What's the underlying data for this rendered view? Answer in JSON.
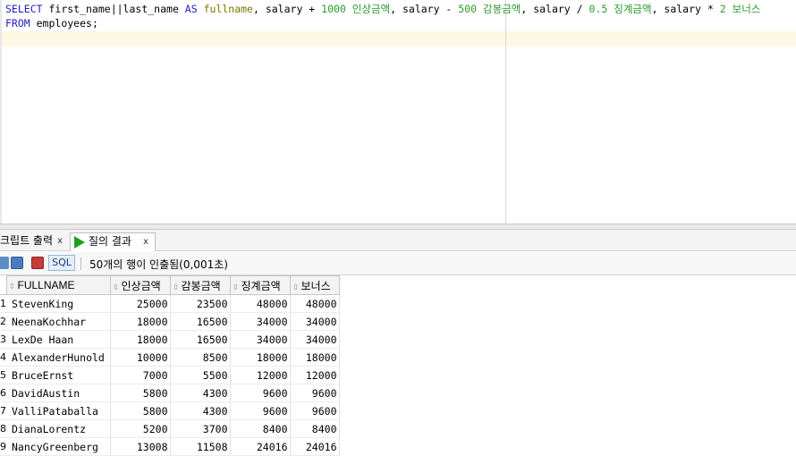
{
  "editor": {
    "line1": [
      {
        "t": "SELECT",
        "c": "kw"
      },
      {
        "t": " first_name||last_name ",
        "c": ""
      },
      {
        "t": "AS",
        "c": "kw"
      },
      {
        "t": " ",
        "c": ""
      },
      {
        "t": "fullname",
        "c": "alias"
      },
      {
        "t": ", salary + ",
        "c": ""
      },
      {
        "t": "1000",
        "c": "num"
      },
      {
        "t": " ",
        "c": ""
      },
      {
        "t": "인상금액",
        "c": "kor"
      },
      {
        "t": ", salary - ",
        "c": ""
      },
      {
        "t": "500",
        "c": "num"
      },
      {
        "t": " ",
        "c": ""
      },
      {
        "t": "감봉금액",
        "c": "kor"
      },
      {
        "t": ", salary / ",
        "c": ""
      },
      {
        "t": "0.5",
        "c": "num"
      },
      {
        "t": " ",
        "c": ""
      },
      {
        "t": "징계금액",
        "c": "kor"
      },
      {
        "t": ", salary * ",
        "c": ""
      },
      {
        "t": "2",
        "c": "num"
      },
      {
        "t": " ",
        "c": ""
      },
      {
        "t": "보너스",
        "c": "kor"
      }
    ],
    "line2": [
      {
        "t": "FROM",
        "c": "kw"
      },
      {
        "t": " employees;",
        "c": ""
      }
    ]
  },
  "tabs": {
    "script_output": "크립트 출력",
    "query_result": "질의 결과",
    "close": "x"
  },
  "toolbar": {
    "sql_label": "SQL",
    "separator": "|",
    "status": "50개의 행이 인출됨(0,001초)"
  },
  "grid": {
    "columns": [
      "FULLNAME",
      "인상금액",
      "감봉금액",
      "징계금액",
      "보너스"
    ],
    "rows": [
      {
        "rn": "1",
        "fullname": "StevenKing",
        "raise": "25000",
        "cut": "23500",
        "penalty": "48000",
        "bonus": "48000"
      },
      {
        "rn": "2",
        "fullname": "NeenaKochhar",
        "raise": "18000",
        "cut": "16500",
        "penalty": "34000",
        "bonus": "34000"
      },
      {
        "rn": "3",
        "fullname": "LexDe Haan",
        "raise": "18000",
        "cut": "16500",
        "penalty": "34000",
        "bonus": "34000"
      },
      {
        "rn": "4",
        "fullname": "AlexanderHunold",
        "raise": "10000",
        "cut": "8500",
        "penalty": "18000",
        "bonus": "18000"
      },
      {
        "rn": "5",
        "fullname": "BruceErnst",
        "raise": "7000",
        "cut": "5500",
        "penalty": "12000",
        "bonus": "12000"
      },
      {
        "rn": "6",
        "fullname": "DavidAustin",
        "raise": "5800",
        "cut": "4300",
        "penalty": "9600",
        "bonus": "9600"
      },
      {
        "rn": "7",
        "fullname": "ValliPataballa",
        "raise": "5800",
        "cut": "4300",
        "penalty": "9600",
        "bonus": "9600"
      },
      {
        "rn": "8",
        "fullname": "DianaLorentz",
        "raise": "5200",
        "cut": "3700",
        "penalty": "8400",
        "bonus": "8400"
      },
      {
        "rn": "9",
        "fullname": "NancyGreenberg",
        "raise": "13008",
        "cut": "11508",
        "penalty": "24016",
        "bonus": "24016"
      }
    ]
  }
}
